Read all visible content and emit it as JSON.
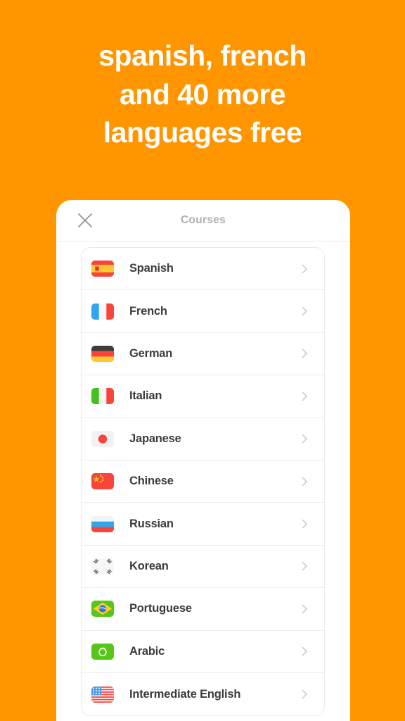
{
  "theme": {
    "background": "#FF9600",
    "card_background": "#FFFFFF",
    "headline_color": "#FFFFFF",
    "title_color": "#AFAFAF",
    "label_color": "#3C3C3C",
    "divider_color": "#EDEDED",
    "chevron_color": "#BDBDBD"
  },
  "headline": {
    "line1": "spanish, french",
    "line2": "and 40 more",
    "line3": "languages free"
  },
  "card": {
    "title": "Courses",
    "close_icon": "close-x-icon",
    "chevron_icon": "chevron-right-icon"
  },
  "courses": [
    {
      "name": "Spanish",
      "flag": "flag-spain"
    },
    {
      "name": "French",
      "flag": "flag-france"
    },
    {
      "name": "German",
      "flag": "flag-germany"
    },
    {
      "name": "Italian",
      "flag": "flag-italy"
    },
    {
      "name": "Japanese",
      "flag": "flag-japan"
    },
    {
      "name": "Chinese",
      "flag": "flag-china"
    },
    {
      "name": "Russian",
      "flag": "flag-russia"
    },
    {
      "name": "Korean",
      "flag": "flag-south-korea"
    },
    {
      "name": "Portuguese",
      "flag": "flag-brazil"
    },
    {
      "name": "Arabic",
      "flag": "flag-arabic"
    },
    {
      "name": "Intermediate English",
      "flag": "flag-united-states"
    }
  ]
}
